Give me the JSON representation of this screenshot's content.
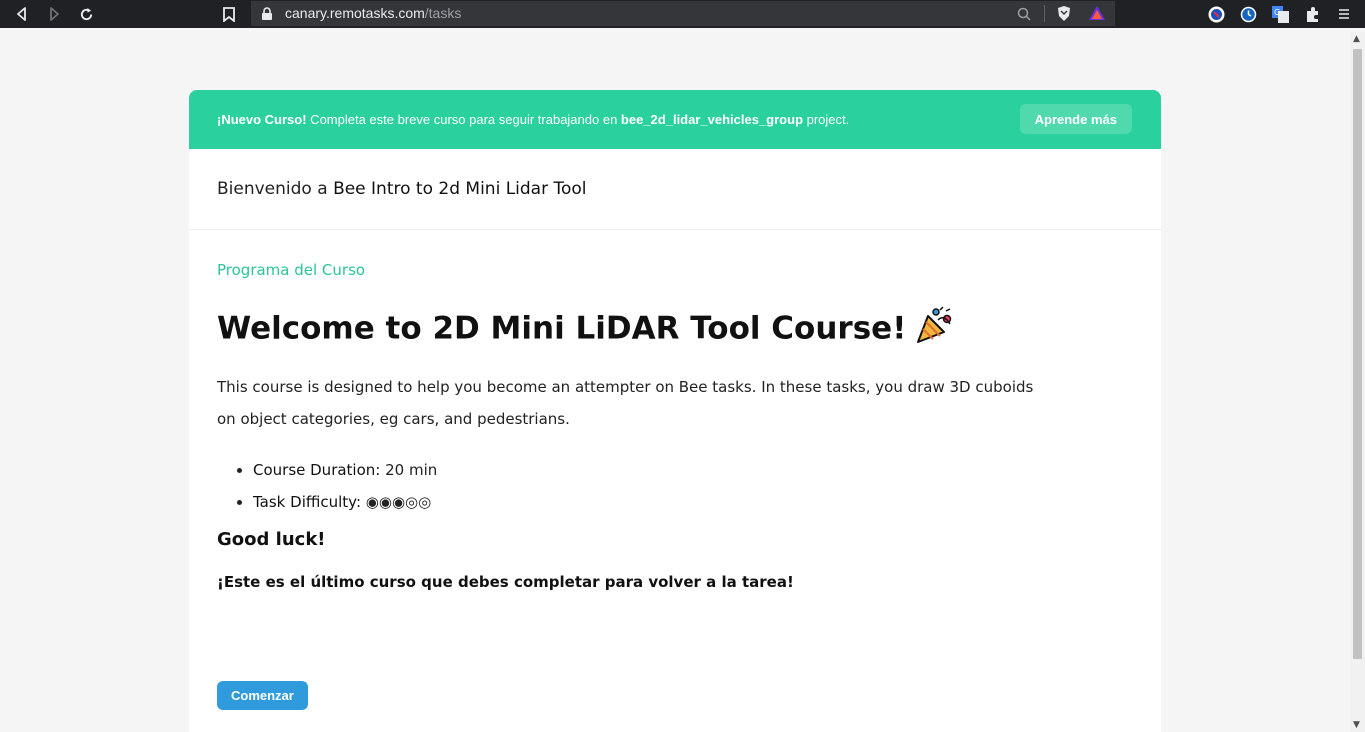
{
  "browser": {
    "url_host": "canary.remotasks.com",
    "url_path": "/tasks"
  },
  "banner": {
    "prefix_bold": "¡Nuevo Curso!",
    "text_a": " Completa este breve curso para seguir trabajando en ",
    "project_bold": "bee_2d_lidar_vehicles_group",
    "text_b": " project.",
    "learn_more_label": "Aprende más"
  },
  "welcome": {
    "prefix": "Bienvenido a ",
    "course_name": "Bee Intro to 2d Mini Lidar Tool"
  },
  "content": {
    "section_label": "Programa del Curso",
    "title": "Welcome to 2D Mini LiDAR Tool Course!",
    "description": "This course is designed to help you become an attempter on Bee tasks. In these tasks, you draw 3D cuboids on object categories, eg cars, and pedestrians.",
    "items": [
      {
        "label": "Course Duration:",
        "value": " 20 min"
      },
      {
        "label": "Task Difficulty:",
        "value": " ◉◉◉◎◎"
      }
    ],
    "good_luck": "Good luck!",
    "last_course": "¡Este es el último curso que debes completar para volver a la tarea!",
    "start_label": "Comenzar"
  },
  "colors": {
    "banner": "#2ad09d",
    "accent_text": "#2ac59a",
    "start_button": "#2f9bdd"
  },
  "icons": [
    "back-icon",
    "forward-icon",
    "reload-icon",
    "bookmark-icon",
    "lock-icon",
    "zoom-icon",
    "brave-shield-icon",
    "brave-rewards-icon",
    "extension-icon",
    "menu-icon",
    "party-popper-icon"
  ]
}
